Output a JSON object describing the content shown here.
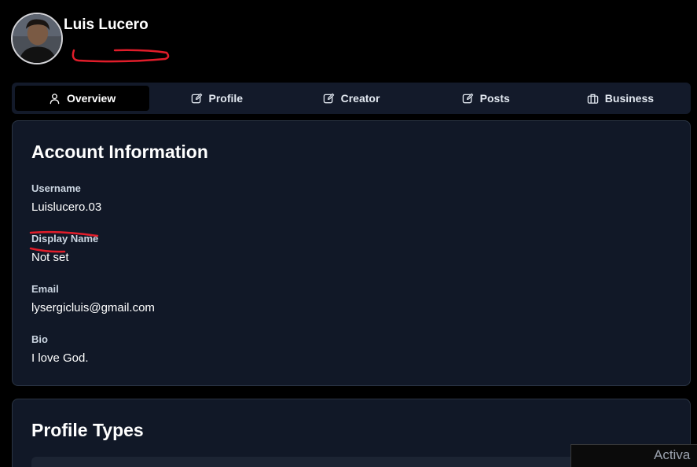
{
  "user": {
    "name": "Luis Lucero"
  },
  "tabs": [
    {
      "label": "Overview",
      "icon": "user-icon",
      "active": true
    },
    {
      "label": "Profile",
      "icon": "edit-icon",
      "active": false
    },
    {
      "label": "Creator",
      "icon": "edit-icon",
      "active": false
    },
    {
      "label": "Posts",
      "icon": "edit-icon",
      "active": false
    },
    {
      "label": "Business",
      "icon": "briefcase-icon",
      "active": false
    }
  ],
  "account": {
    "title": "Account Information",
    "fields": [
      {
        "label": "Username",
        "value": "Luislucero.03"
      },
      {
        "label": "Display Name",
        "value": "Not set"
      },
      {
        "label": "Email",
        "value": "lysergicluis@gmail.com"
      },
      {
        "label": "Bio",
        "value": "I love God."
      }
    ]
  },
  "profile_types": {
    "title": "Profile Types"
  },
  "overlay": {
    "text": "Activa"
  },
  "colors": {
    "background": "#000000",
    "card": "#111827",
    "tab_bar": "#131a2a",
    "annotation_red": "#e11d2a"
  }
}
